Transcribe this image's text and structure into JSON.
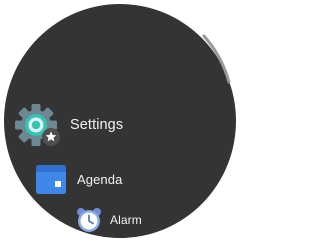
{
  "apps": [
    {
      "label": "Settings",
      "icon": "settings-gear-icon",
      "badge_icon": "star-icon",
      "selected": true
    },
    {
      "label": "Agenda",
      "icon": "calendar-icon"
    },
    {
      "label": "Alarm",
      "icon": "alarm-clock-icon"
    }
  ],
  "colors": {
    "face_background": "#343434",
    "label_text": "#f2f2f2",
    "settings_gear": "#6d8793",
    "settings_ring": "#2fc6b4",
    "agenda_blue": "#3f87e8",
    "alarm_blue": "#89a9e8",
    "scroll_indicator": "#9a9a9a"
  }
}
